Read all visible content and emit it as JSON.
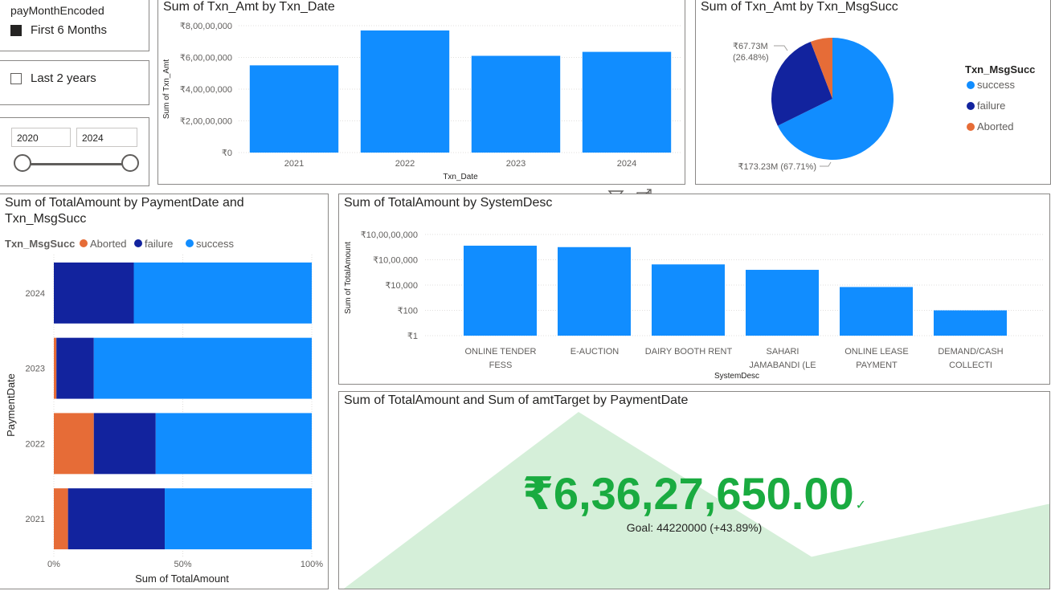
{
  "slicers": {
    "pay_month": {
      "title": "payMonthEncoded",
      "option": "First 6 Months",
      "checked": true
    },
    "last_years": {
      "option": "Last 2 years",
      "checked": false
    },
    "year_range": {
      "from": "2020",
      "to": "2024"
    }
  },
  "colors": {
    "success": "#118DFF",
    "failure": "#12239E",
    "aborted": "#E66C37",
    "kpi": "#1AAB40",
    "area": "#D5EFD9"
  },
  "header_icons": [
    "filter-icon",
    "focus-mode-icon",
    "more-options-icon"
  ],
  "chart_data": [
    {
      "id": "txn-by-date",
      "type": "bar",
      "title": "Sum of Txn_Amt by Txn_Date",
      "xlabel": "Txn_Date",
      "ylabel": "Sum of Txn_Amt",
      "categories": [
        "2021",
        "2022",
        "2023",
        "2024"
      ],
      "values": [
        55000000,
        77000000,
        61000000,
        63500000
      ],
      "ylim": [
        0,
        80000000
      ],
      "yticks": [
        {
          "value": 0,
          "label": "₹0"
        },
        {
          "value": 20000000,
          "label": "₹2,00,00,000"
        },
        {
          "value": 40000000,
          "label": "₹4,00,00,000"
        },
        {
          "value": 60000000,
          "label": "₹6,00,00,000"
        },
        {
          "value": 80000000,
          "label": "₹8,00,00,000"
        }
      ],
      "grid": true
    },
    {
      "id": "txn-by-msgsucc",
      "type": "pie",
      "title": "Sum of Txn_Amt by Txn_MsgSucc",
      "legend_title": "Txn_MsgSucc",
      "legend_position": "right",
      "slices": [
        {
          "name": "success",
          "value": 173.23,
          "color": "#118DFF",
          "label": "₹173.23M (67.71%)"
        },
        {
          "name": "failure",
          "value": 67.73,
          "color": "#12239E",
          "label_line1": "₹67.73M",
          "label_line2": "(26.48%)"
        },
        {
          "name": "Aborted",
          "value": 14.88,
          "color": "#E66C37"
        }
      ]
    },
    {
      "id": "totalamount-by-paymentdate",
      "type": "bar",
      "orientation": "horizontal",
      "stacked": "100%",
      "title_line1": "Sum of TotalAmount by PaymentDate and",
      "title_line2": "Txn_MsgSucc",
      "legend_title": "Txn_MsgSucc",
      "legend_position": "top-left",
      "xlabel": "Sum of TotalAmount",
      "ylabel": "PaymentDate",
      "categories": [
        "2024",
        "2023",
        "2022",
        "2021"
      ],
      "series": [
        {
          "name": "Aborted",
          "values": [
            0,
            0.01,
            0.155,
            0.055
          ],
          "color": "#E66C37"
        },
        {
          "name": "failure",
          "values": [
            0.31,
            0.145,
            0.24,
            0.375
          ],
          "color": "#12239E"
        },
        {
          "name": "success",
          "values": [
            0.69,
            0.845,
            0.605,
            0.57
          ],
          "color": "#118DFF"
        }
      ],
      "xticks": [
        {
          "value": 0,
          "label": "0%"
        },
        {
          "value": 0.5,
          "label": "50%"
        },
        {
          "value": 1,
          "label": "100%"
        }
      ],
      "grid": true
    },
    {
      "id": "totalamount-by-systemdesc",
      "type": "bar",
      "title": "Sum of TotalAmount by SystemDesc",
      "xlabel": "SystemDesc",
      "ylabel": "Sum of TotalAmount",
      "yscale": "log",
      "categories": [
        [
          "ONLINE TENDER",
          "FESS"
        ],
        [
          "E-AUCTION"
        ],
        [
          "DAIRY BOOTH RENT"
        ],
        [
          "SAHARI",
          "JAMABANDI (LE"
        ],
        [
          "ONLINE LEASE",
          "PAYMENT"
        ],
        [
          "DEMAND/CASH",
          "COLLECTI"
        ]
      ],
      "values": [
        13000000,
        10000000,
        430000,
        160000,
        7000,
        100
      ],
      "ylim": [
        1,
        10000000
      ],
      "yticks": [
        {
          "value": 1,
          "label": "₹1"
        },
        {
          "value": 100,
          "label": "₹100"
        },
        {
          "value": 10000,
          "label": "₹10,000"
        },
        {
          "value": 1000000,
          "label": "₹10,00,000"
        },
        {
          "value": 100000000,
          "label": "₹10,00,00,000"
        }
      ],
      "grid": true
    },
    {
      "id": "kpi-totalamount-vs-target",
      "type": "area",
      "title": "Sum of TotalAmount and Sum of amtTarget by PaymentDate",
      "kpi_value": "₹6,36,27,650.00",
      "kpi_status": "✓",
      "goal_text": "Goal: 44220000 (+43.89%)",
      "trend_values": [
        0,
        100,
        18,
        48
      ],
      "trend_max": 100
    }
  ]
}
